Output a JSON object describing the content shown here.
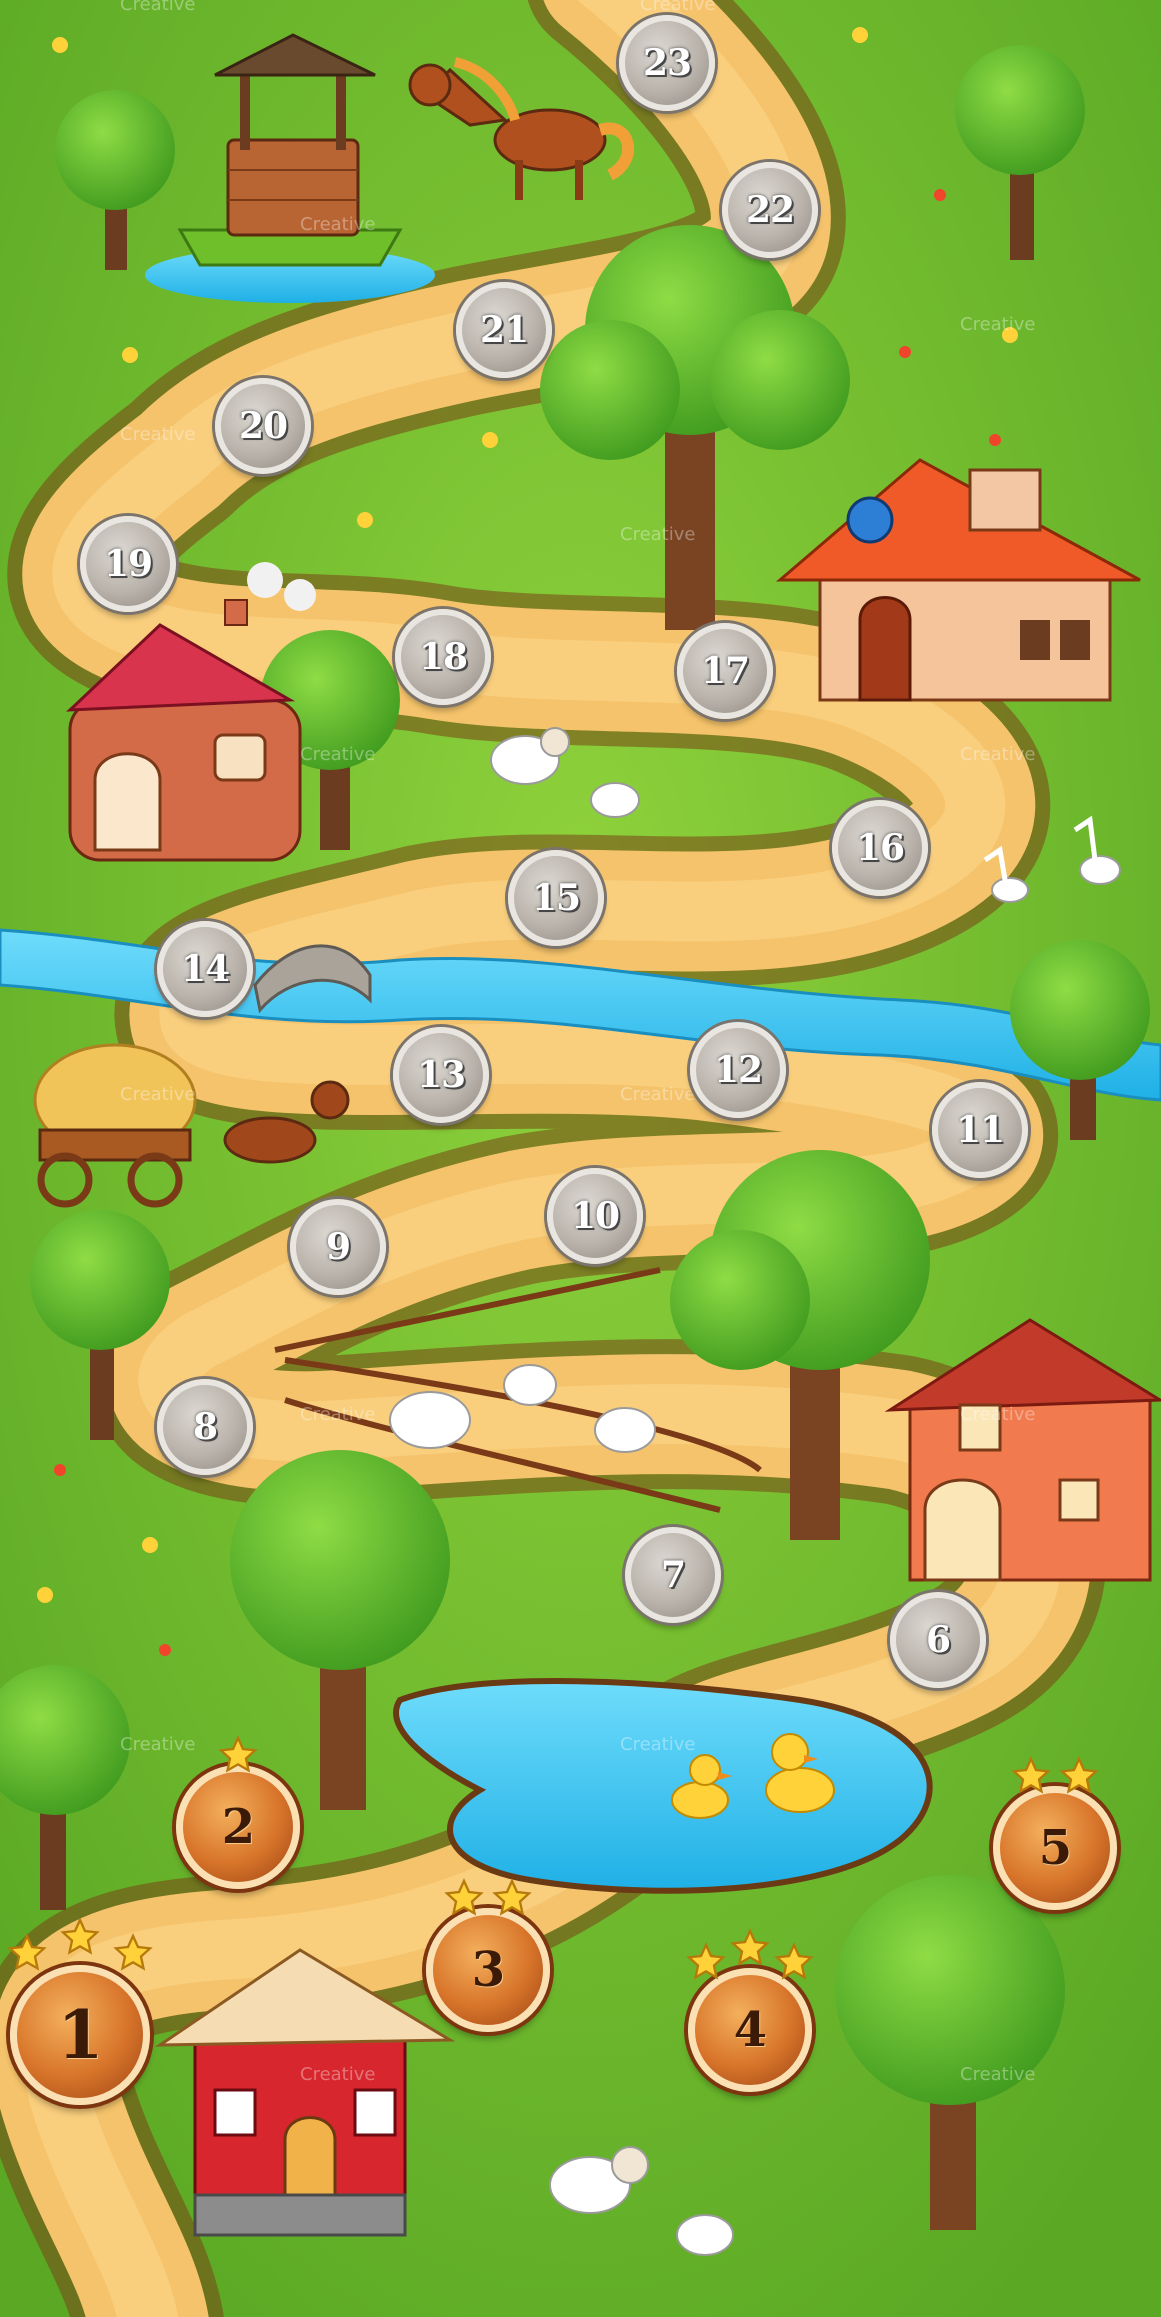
{
  "levels": [
    {
      "number": "1",
      "state": "unlocked",
      "stars": 3
    },
    {
      "number": "2",
      "state": "unlocked",
      "stars": 1
    },
    {
      "number": "3",
      "state": "unlocked",
      "stars": 2
    },
    {
      "number": "4",
      "state": "unlocked",
      "stars": 3
    },
    {
      "number": "5",
      "state": "unlocked",
      "stars": 2
    },
    {
      "number": "6",
      "state": "locked",
      "stars": 0
    },
    {
      "number": "7",
      "state": "locked",
      "stars": 0
    },
    {
      "number": "8",
      "state": "locked",
      "stars": 0
    },
    {
      "number": "9",
      "state": "locked",
      "stars": 0
    },
    {
      "number": "10",
      "state": "locked",
      "stars": 0
    },
    {
      "number": "11",
      "state": "locked",
      "stars": 0
    },
    {
      "number": "12",
      "state": "locked",
      "stars": 0
    },
    {
      "number": "13",
      "state": "locked",
      "stars": 0
    },
    {
      "number": "14",
      "state": "locked",
      "stars": 0
    },
    {
      "number": "15",
      "state": "locked",
      "stars": 0
    },
    {
      "number": "16",
      "state": "locked",
      "stars": 0
    },
    {
      "number": "17",
      "state": "locked",
      "stars": 0
    },
    {
      "number": "18",
      "state": "locked",
      "stars": 0
    },
    {
      "number": "19",
      "state": "locked",
      "stars": 0
    },
    {
      "number": "20",
      "state": "locked",
      "stars": 0
    },
    {
      "number": "21",
      "state": "locked",
      "stars": 0
    },
    {
      "number": "22",
      "state": "locked",
      "stars": 0
    },
    {
      "number": "23",
      "state": "locked",
      "stars": 0
    }
  ],
  "watermark": "Creative",
  "colors": {
    "grass": "#6cbf2c",
    "path": "#f5c36b",
    "river": "#35c4ee",
    "star": "#ffd23a"
  }
}
